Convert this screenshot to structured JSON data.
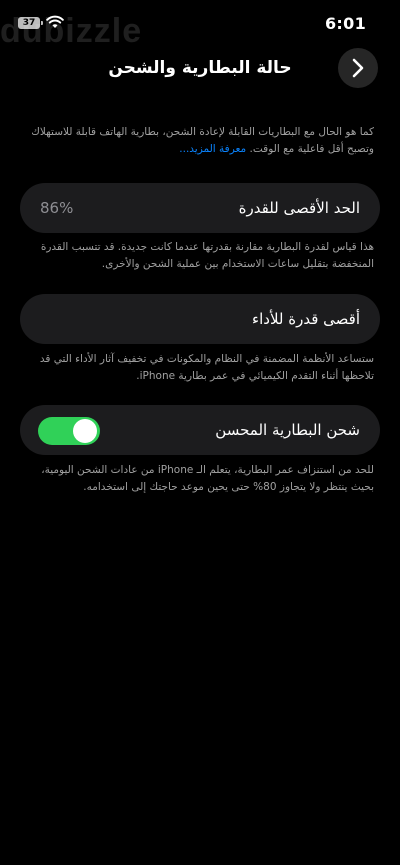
{
  "status_bar": {
    "time": "6:01",
    "battery_level": "37"
  },
  "watermark": "dubizzle",
  "header": {
    "title": "حالة البطارية والشحن"
  },
  "intro": {
    "text": "كما هو الحال مع البطاريات القابلة لإعادة الشحن، بطارية الهاتف قابلة للاستهلاك وتصبح أقل فاعلية مع الوقت.",
    "link": "معرفة المزيد..."
  },
  "max_capacity": {
    "label": "الحد الأقصى للقدرة",
    "value": "86%",
    "description": "هذا قياس لقدرة البطارية مقارنة بقدرتها عندما كانت جديدة. قد تتسبب القدرة المنخفضة بتقليل ساعات الاستخدام بين عملية الشحن والأخرى."
  },
  "peak_performance": {
    "label": "أقصى قدرة للأداء",
    "description": "ستساعد الأنظمة المضمنة في النظام والمكونات في تخفيف آثار الأداء التي قد تلاحظها أثناء التقدم الكيميائي في عمر بطارية iPhone."
  },
  "optimized_charging": {
    "label": "شحن البطارية المحسن",
    "enabled": true,
    "description": "للحد من استنزاف عمر البطارية، يتعلم الـ iPhone من عادات الشحن اليومية، بحيث ينتظر ولا يتجاوز 80% حتى يحين موعد حاجتك إلى استخدامه."
  },
  "colors": {
    "accent_link": "#0a84ff",
    "toggle_on": "#30d158",
    "card_bg": "#1c1c1e"
  }
}
